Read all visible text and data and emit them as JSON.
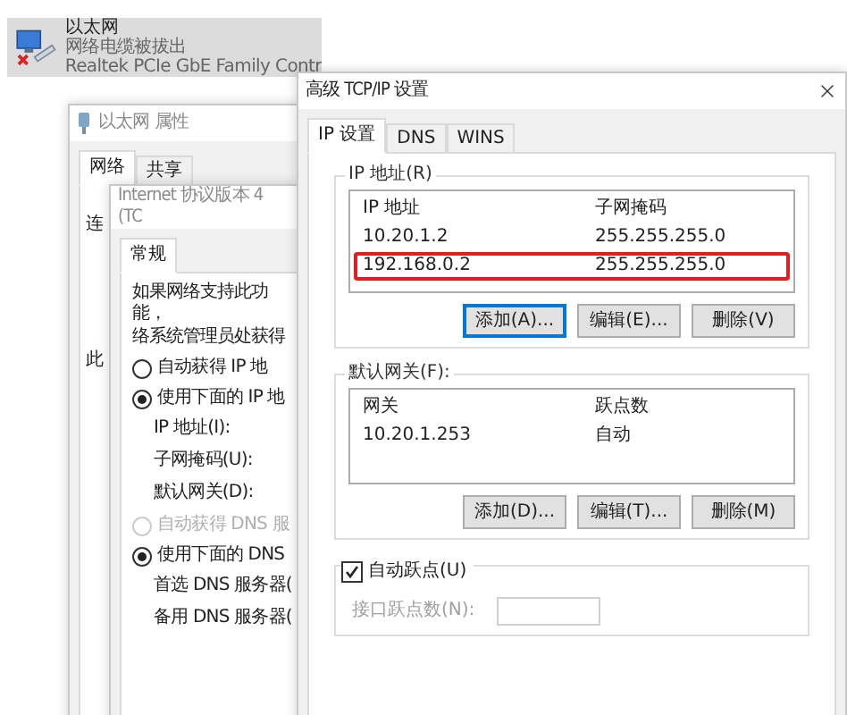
{
  "adapter": {
    "name": "以太网",
    "status": "网络电缆被拔出",
    "device": "Realtek PCIe GbE Family Contr"
  },
  "properties_window": {
    "title": "以太网 属性",
    "tabs": [
      {
        "label": "网络",
        "selected": true
      },
      {
        "label": "共享",
        "selected": false
      }
    ],
    "fragments": [
      "连",
      "此"
    ]
  },
  "ipv4_window": {
    "title": "Internet 协议版本 4 (TC",
    "tabs": [
      {
        "label": "常规",
        "selected": true
      }
    ],
    "description": [
      "如果网络支持此功能，",
      "络系统管理员处获得"
    ],
    "items": [
      {
        "kind": "radio",
        "label": "自动获得 IP 地",
        "selected": false,
        "disabled": false
      },
      {
        "kind": "radio",
        "label": "使用下面的 IP 地",
        "selected": true,
        "disabled": false
      },
      {
        "kind": "field",
        "label": "IP 地址(I):"
      },
      {
        "kind": "field",
        "label": "子网掩码(U):"
      },
      {
        "kind": "field",
        "label": "默认网关(D):"
      },
      {
        "kind": "radio",
        "label": "自动获得 DNS 服",
        "selected": false,
        "disabled": true
      },
      {
        "kind": "radio",
        "label": "使用下面的 DNS",
        "selected": true,
        "disabled": false
      },
      {
        "kind": "field",
        "label": "首选 DNS 服务器("
      },
      {
        "kind": "field",
        "label": "备用 DNS 服务器("
      }
    ]
  },
  "advanced_window": {
    "title": "高级 TCP/IP 设置",
    "tabs": [
      {
        "label": "IP 设置",
        "selected": true
      },
      {
        "label": "DNS",
        "selected": false
      },
      {
        "label": "WINS",
        "selected": false
      }
    ],
    "ip_group": {
      "legend": "IP 地址(R)",
      "columns": [
        "IP 地址",
        "子网掩码"
      ],
      "rows": [
        {
          "cells": [
            "10.20.1.2",
            "255.255.255.0"
          ],
          "highlighted": false
        },
        {
          "cells": [
            "192.168.0.2",
            "255.255.255.0"
          ],
          "highlighted": true
        }
      ],
      "buttons": [
        {
          "label": "添加(A)...",
          "focused": true
        },
        {
          "label": "编辑(E)...",
          "focused": false
        },
        {
          "label": "删除(V)",
          "focused": false
        }
      ]
    },
    "gateway_group": {
      "legend": "默认网关(F):",
      "columns": [
        "网关",
        "跃点数"
      ],
      "rows": [
        {
          "cells": [
            "10.20.1.253",
            "自动"
          ],
          "highlighted": false
        }
      ],
      "buttons": [
        {
          "label": "添加(D)...",
          "focused": false
        },
        {
          "label": "编辑(T)...",
          "focused": false
        },
        {
          "label": "删除(M)",
          "focused": false
        }
      ]
    },
    "automatic_metric": {
      "label": "自动跃点(U)",
      "checked": true
    },
    "interface_metric": {
      "label": "接口跃点数(N):",
      "disabled": true
    }
  }
}
